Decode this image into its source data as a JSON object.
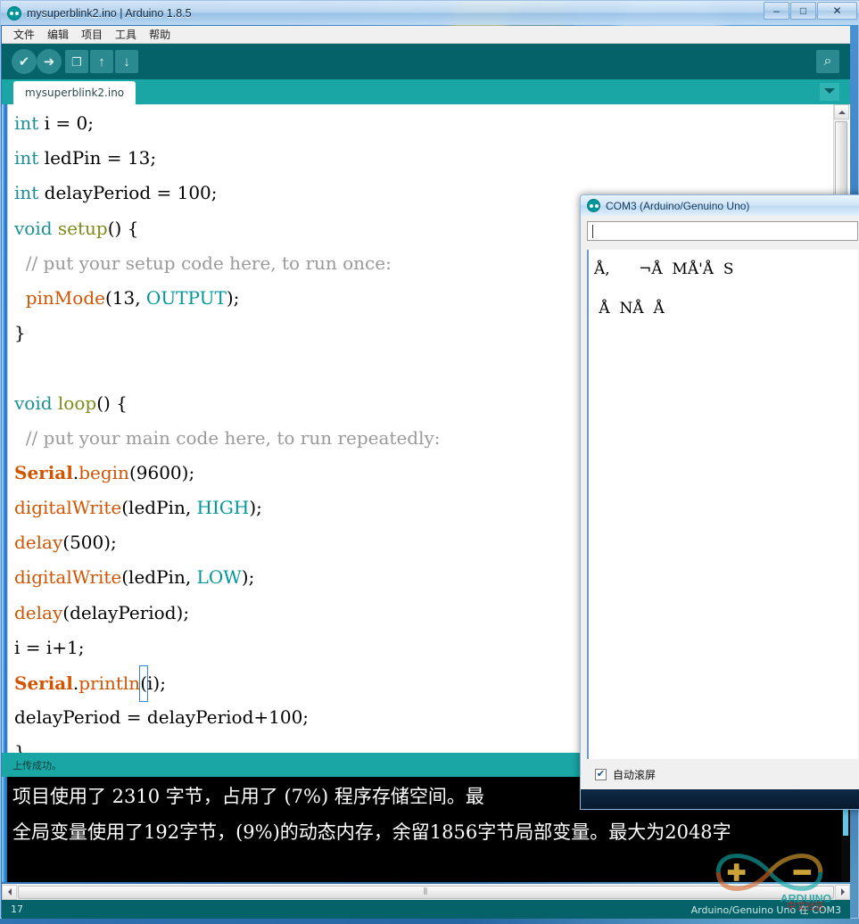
{
  "window": {
    "title": "mysuperblink2.ino | Arduino 1.8.5",
    "app_icon": "arduino-logo-icon",
    "minimize_label": "–",
    "maximize_label": "□",
    "close_label": "✕"
  },
  "menu": {
    "items": [
      {
        "label": "文件"
      },
      {
        "label": "编辑"
      },
      {
        "label": "项目"
      },
      {
        "label": "工具"
      },
      {
        "label": "帮助"
      }
    ]
  },
  "toolbar": {
    "verify_glyph": "✔",
    "upload_glyph": "➜",
    "new_glyph": "❐",
    "open_glyph": "↑",
    "save_glyph": "↓",
    "serial_monitor_glyph": "⌕",
    "verify_label": "Verify",
    "upload_label": "Upload",
    "new_label": "New",
    "open_label": "Open",
    "save_label": "Save",
    "serial_monitor_label": "Serial Monitor"
  },
  "tabs": {
    "active": "mysuperblink2.ino",
    "dropdown_glyph": "▾"
  },
  "editor": {
    "lines": [
      {
        "segs": [
          {
            "t": "int ",
            "c": "k-kw"
          },
          {
            "t": "i = 0;",
            "c": ""
          }
        ]
      },
      {
        "segs": [
          {
            "t": "int ",
            "c": "k-kw"
          },
          {
            "t": "ledPin = 13;",
            "c": ""
          }
        ]
      },
      {
        "segs": [
          {
            "t": "int ",
            "c": "k-kw"
          },
          {
            "t": "delayPeriod = 100;",
            "c": ""
          }
        ]
      },
      {
        "segs": [
          {
            "t": "void ",
            "c": "k-kw"
          },
          {
            "t": "setup",
            "c": "k-fn"
          },
          {
            "t": "() {",
            "c": ""
          }
        ]
      },
      {
        "segs": [
          {
            "t": "  // put your setup code here, to run once:",
            "c": "k-cmt"
          }
        ]
      },
      {
        "segs": [
          {
            "t": "  pinMode",
            "c": "k-fun"
          },
          {
            "t": "(13, ",
            "c": ""
          },
          {
            "t": "OUTPUT",
            "c": "k-const"
          },
          {
            "t": ");",
            "c": ""
          }
        ]
      },
      {
        "segs": [
          {
            "t": "}",
            "c": ""
          }
        ]
      },
      {
        "segs": [
          {
            "t": "",
            "c": ""
          }
        ]
      },
      {
        "segs": [
          {
            "t": "void ",
            "c": "k-kw"
          },
          {
            "t": "loop",
            "c": "k-fn"
          },
          {
            "t": "() {",
            "c": ""
          }
        ]
      },
      {
        "segs": [
          {
            "t": "  // put your main code here, to run repeatedly:",
            "c": "k-cmt"
          }
        ]
      },
      {
        "segs": [
          {
            "t": "Serial",
            "c": "k-ser"
          },
          {
            "t": ".",
            "c": ""
          },
          {
            "t": "begin",
            "c": "k-fun"
          },
          {
            "t": "(9600);",
            "c": ""
          }
        ]
      },
      {
        "segs": [
          {
            "t": "digitalWrite",
            "c": "k-fun"
          },
          {
            "t": "(ledPin, ",
            "c": ""
          },
          {
            "t": "HIGH",
            "c": "k-const"
          },
          {
            "t": ");",
            "c": ""
          }
        ]
      },
      {
        "segs": [
          {
            "t": "delay",
            "c": "k-fun"
          },
          {
            "t": "(500);",
            "c": ""
          }
        ]
      },
      {
        "segs": [
          {
            "t": "digitalWrite",
            "c": "k-fun"
          },
          {
            "t": "(ledPin, ",
            "c": ""
          },
          {
            "t": "LOW",
            "c": "k-const"
          },
          {
            "t": ");",
            "c": ""
          }
        ]
      },
      {
        "segs": [
          {
            "t": "delay",
            "c": "k-fun"
          },
          {
            "t": "(delayPeriod);",
            "c": ""
          }
        ]
      },
      {
        "segs": [
          {
            "t": "i = i+1;",
            "c": ""
          }
        ]
      },
      {
        "segs": [
          {
            "t": "Serial",
            "c": "k-ser"
          },
          {
            "t": ".",
            "c": ""
          },
          {
            "t": "println",
            "c": "k-fun"
          },
          {
            "t": "(",
            "c": "caretbox"
          },
          {
            "t": "i);",
            "c": ""
          }
        ]
      },
      {
        "segs": [
          {
            "t": "delayPeriod = delayPeriod+100;",
            "c": ""
          }
        ]
      },
      {
        "segs": [
          {
            "t": "}",
            "c": ""
          }
        ]
      }
    ]
  },
  "status": {
    "message": "上传成功。"
  },
  "console": {
    "line1": "项目使用了 2310 字节，占用了 (7%) 程序存储空间。最",
    "line2": "全局变量使用了192字节，(9%)的动态内存，余留1856字节局部变量。最大为2048字"
  },
  "hscroll": {
    "left_glyph": "◂",
    "right_glyph": "▸",
    "grip": "⦀"
  },
  "bottom_bar": {
    "line_number": "17",
    "board_info": "Arduino/Genuino Uno 在 COM3"
  },
  "serial_monitor": {
    "title": "COM3 (Arduino/Genuino Uno)",
    "icon": "arduino-logo-icon",
    "send_input_value": "",
    "send_input_placeholder": "",
    "output_line1": "Å,      ¬Å  MÅ'Å  S",
    "output_line2": " Å  NÅ  Å",
    "autoscroll_label": "自动滚屏",
    "autoscroll_checked": true,
    "autoscroll_check_glyph": "✔"
  },
  "colors": {
    "toolbar_teal": "#046268",
    "tabbar_teal": "#1ba6a6",
    "console_bg": "#000000",
    "keyword": "#1a8f96",
    "function": "#d35400",
    "constant": "#00979c",
    "comment": "#9a9a9a",
    "accent_blue": "#2b86d8"
  }
}
